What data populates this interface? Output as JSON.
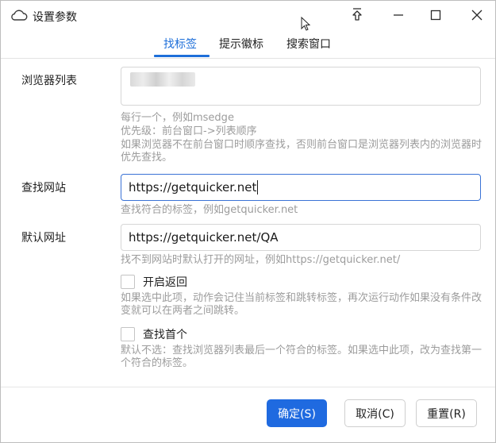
{
  "window": {
    "title": "设置参数"
  },
  "tabs": [
    {
      "label": "找标签",
      "active": true
    },
    {
      "label": "提示徽标",
      "active": false
    },
    {
      "label": "搜索窗口",
      "active": false
    }
  ],
  "form": {
    "browser_list": {
      "label": "浏览器列表",
      "hint_line1": "每行一个，例如msedge",
      "hint_line2": "优先级：前台窗口->列表顺序",
      "hint_line3": "如果浏览器不在前台窗口时顺序查找，否则前台窗口是浏览器列表内的浏览器时优先查找。"
    },
    "find_site": {
      "label": "查找网站",
      "value": "https://getquicker.net",
      "hint": "查找符合的标签，例如getquicker.net"
    },
    "default_url": {
      "label": "默认网址",
      "value": "https://getquicker.net/QA",
      "hint": "找不到网站时默认打开的网址，例如https://getquicker.net/"
    },
    "enable_return": {
      "label": "开启返回",
      "checked": false,
      "hint": "如果选中此项，动作会记住当前标签和跳转标签，再次运行动作如果没有条件改变就可以在两者之间跳转。"
    },
    "find_first": {
      "label": "查找首个",
      "checked": false,
      "hint": "默认不选：查找浏览器列表最后一个符合的标签。如果选中此项，改为查找第一个符合的标签。"
    }
  },
  "buttons": {
    "ok": "确定(S)",
    "cancel": "取消(C)",
    "reset": "重置(R)"
  },
  "colors": {
    "accent": "#1e6fd9",
    "primary_button": "#1f6ae0",
    "hint_text": "#9c9c9c"
  },
  "icons": {
    "app": "cloud-icon",
    "pin": "pin-icon",
    "minimize": "minimize-icon",
    "maximize": "maximize-icon",
    "close": "close-icon"
  }
}
